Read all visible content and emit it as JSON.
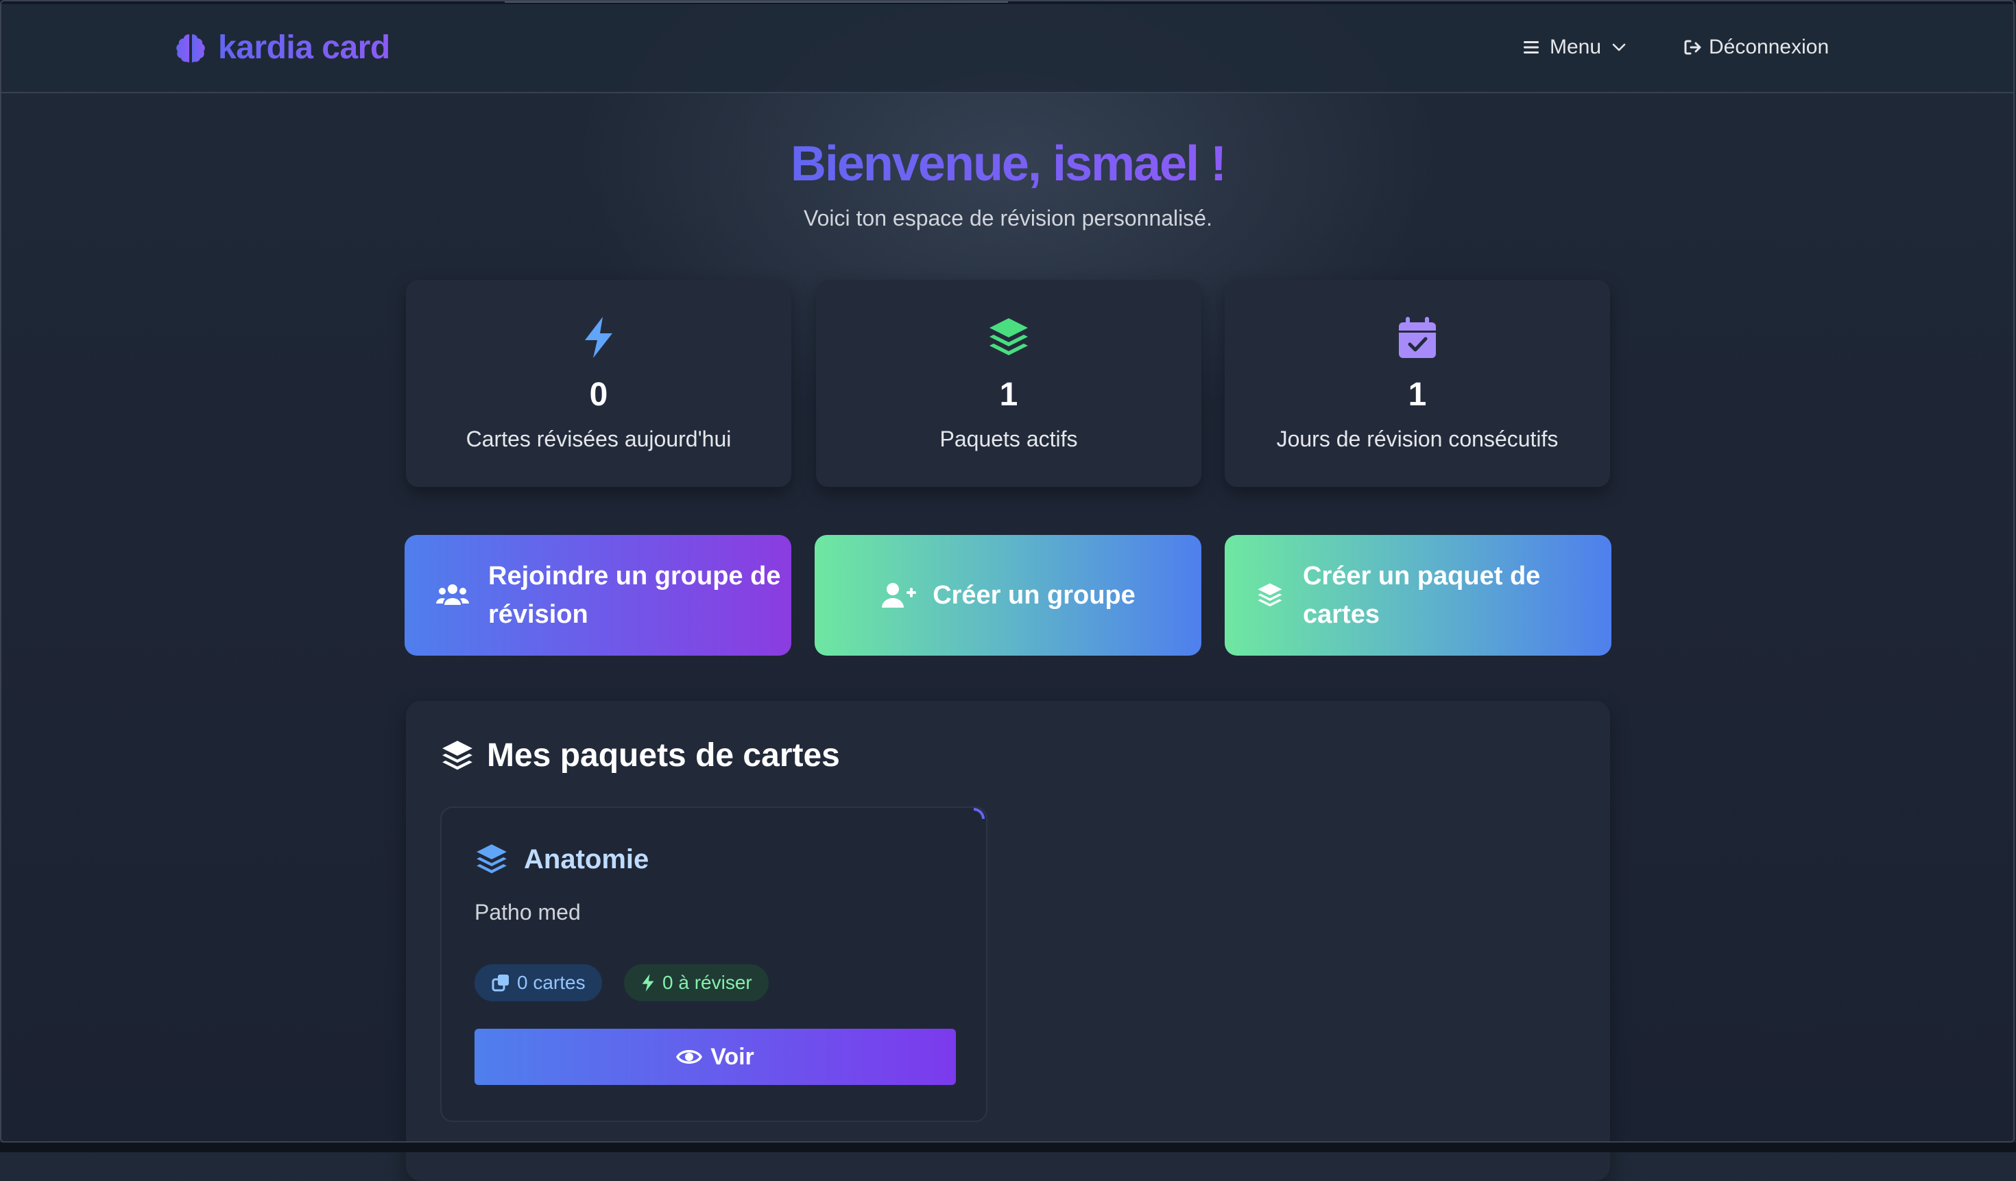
{
  "nav": {
    "brand": "kardia card",
    "menu_label": "Menu",
    "logout_label": "Déconnexion"
  },
  "hero": {
    "title": "Bienvenue, ismael !",
    "subtitle": "Voici ton espace de révision personnalisé."
  },
  "stats": [
    {
      "value": "0",
      "label": "Cartes révisées aujourd'hui",
      "icon": "bolt-icon",
      "color": "#60a5fa"
    },
    {
      "value": "1",
      "label": "Paquets actifs",
      "icon": "layers-icon",
      "color": "#4ade80"
    },
    {
      "value": "1",
      "label": "Jours de révision consécutifs",
      "icon": "calendar-check-icon",
      "color": "#a78bfa"
    }
  ],
  "actions": [
    {
      "label_line1": "Rejoindre un groupe de",
      "label_line2": "révision",
      "icon": "users-icon"
    },
    {
      "label_line1": "Créer un groupe",
      "icon": "user-plus-icon"
    },
    {
      "label_line1": "Créer un paquet de",
      "label_line2": "cartes",
      "icon": "layers-icon"
    }
  ],
  "decks_section": {
    "title": "Mes paquets de cartes",
    "decks": [
      {
        "name": "Anatomie",
        "description": "Patho med",
        "cards_badge": "0 cartes",
        "review_badge": "0 à réviser",
        "view_label": "Voir"
      }
    ]
  },
  "colors": {
    "accent_indigo": "#6366f1",
    "accent_purple": "#8b5cf6",
    "accent_blue": "#4f7fed",
    "accent_green": "#6ee7a1"
  }
}
